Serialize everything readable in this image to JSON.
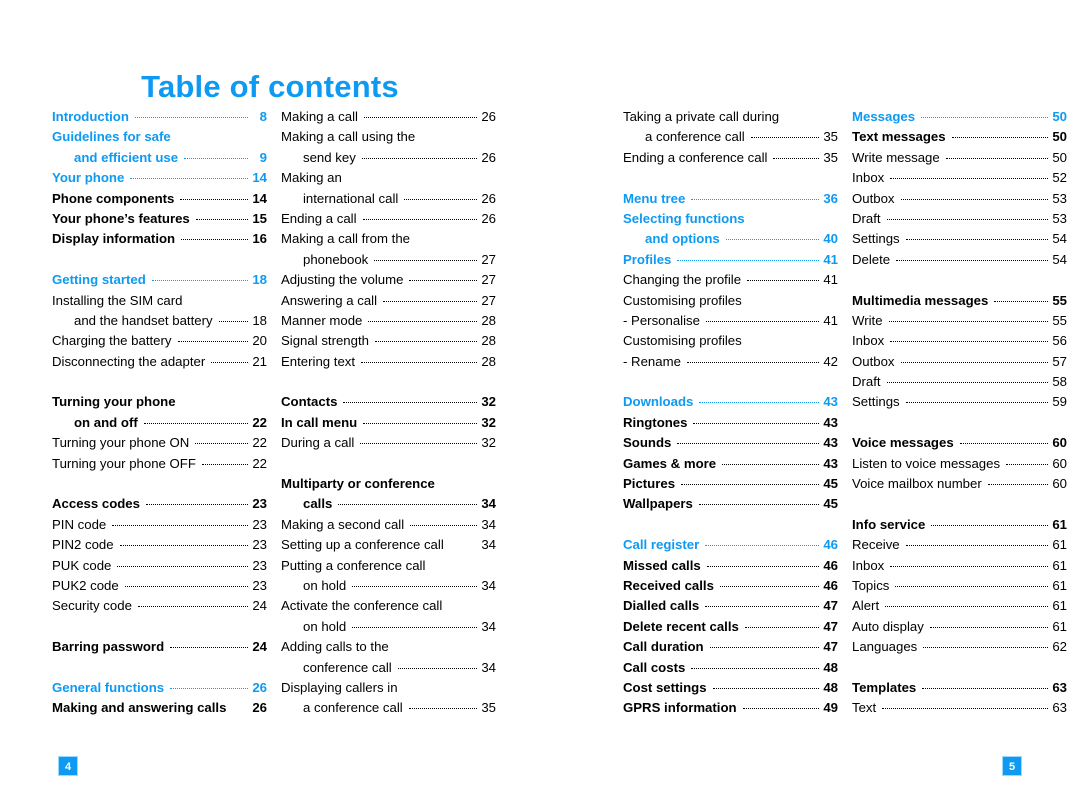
{
  "document": {
    "title": "Table of contents",
    "accent_color": "#0d9af2",
    "text_color": "#000000",
    "background_color": "#ffffff",
    "left_page_number": "4",
    "right_page_number": "5"
  },
  "columns": [
    {
      "id": "column-1",
      "entries": [
        {
          "label": "Introduction",
          "page": "8",
          "level": "section",
          "indent": false,
          "leader": true
        },
        {
          "label": "Guidelines for safe",
          "page": "",
          "level": "section",
          "indent": false,
          "leader": false
        },
        {
          "label": "and efficient use",
          "page": "9",
          "level": "section",
          "indent": true,
          "leader": true
        },
        {
          "label": "Your phone",
          "page": "14",
          "level": "section",
          "indent": false,
          "leader": true
        },
        {
          "label": "Phone components",
          "page": "14",
          "level": "sub",
          "indent": false,
          "leader": true
        },
        {
          "label": "Your phone’s features",
          "page": "15",
          "level": "sub",
          "indent": false,
          "leader": true
        },
        {
          "label": "Display information",
          "page": "16",
          "level": "sub",
          "indent": false,
          "leader": true
        },
        {
          "spacer": true
        },
        {
          "label": "Getting started",
          "page": "18",
          "level": "section",
          "indent": false,
          "leader": true
        },
        {
          "label": "Installing the SIM card",
          "page": "",
          "level": "item",
          "indent": false,
          "leader": false
        },
        {
          "label": "and the handset battery",
          "page": "18",
          "level": "item",
          "indent": true,
          "leader": true
        },
        {
          "label": "Charging the battery",
          "page": "20",
          "level": "item",
          "indent": false,
          "leader": true
        },
        {
          "label": "Disconnecting the adapter",
          "page": "21",
          "level": "item",
          "indent": false,
          "leader": true
        },
        {
          "spacer": true
        },
        {
          "label": "Turning your phone",
          "page": "",
          "level": "sub",
          "indent": false,
          "leader": false
        },
        {
          "label": "on and off",
          "page": "22",
          "level": "sub",
          "indent": true,
          "leader": true
        },
        {
          "label": "Turning your phone ON",
          "page": "22",
          "level": "item",
          "indent": false,
          "leader": true
        },
        {
          "label": "Turning your phone OFF",
          "page": "22",
          "level": "item",
          "indent": false,
          "leader": true
        },
        {
          "spacer": true
        },
        {
          "label": "Access codes",
          "page": "23",
          "level": "sub",
          "indent": false,
          "leader": true
        },
        {
          "label": "PIN code",
          "page": "23",
          "level": "item",
          "indent": false,
          "leader": true
        },
        {
          "label": "PIN2 code",
          "page": "23",
          "level": "item",
          "indent": false,
          "leader": true
        },
        {
          "label": "PUK code",
          "page": "23",
          "level": "item",
          "indent": false,
          "leader": true
        },
        {
          "label": "PUK2 code",
          "page": "23",
          "level": "item",
          "indent": false,
          "leader": true
        },
        {
          "label": "Security code",
          "page": "24",
          "level": "item",
          "indent": false,
          "leader": true
        },
        {
          "spacer": true
        },
        {
          "label": "Barring password",
          "page": "24",
          "level": "sub",
          "indent": false,
          "leader": true
        },
        {
          "spacer": true
        },
        {
          "label": "General functions",
          "page": "26",
          "level": "section",
          "indent": false,
          "leader": true
        },
        {
          "label": "Making and answering calls",
          "page": "26",
          "level": "sub",
          "indent": false,
          "leader": false
        }
      ]
    },
    {
      "id": "column-2",
      "entries": [
        {
          "label": "Making a call",
          "page": "26",
          "level": "item",
          "indent": false,
          "leader": true
        },
        {
          "label": "Making a call using the",
          "page": "",
          "level": "item",
          "indent": false,
          "leader": false
        },
        {
          "label": "send key",
          "page": "26",
          "level": "item",
          "indent": true,
          "leader": true
        },
        {
          "label": "Making an",
          "page": "",
          "level": "item",
          "indent": false,
          "leader": false
        },
        {
          "label": "international call",
          "page": "26",
          "level": "item",
          "indent": true,
          "leader": true
        },
        {
          "label": "Ending a call",
          "page": "26",
          "level": "item",
          "indent": false,
          "leader": true
        },
        {
          "label": "Making a call from the",
          "page": "",
          "level": "item",
          "indent": false,
          "leader": false
        },
        {
          "label": "phonebook",
          "page": "27",
          "level": "item",
          "indent": true,
          "leader": true
        },
        {
          "label": "Adjusting the volume",
          "page": "27",
          "level": "item",
          "indent": false,
          "leader": true
        },
        {
          "label": "Answering a call",
          "page": "27",
          "level": "item",
          "indent": false,
          "leader": true
        },
        {
          "label": "Manner mode",
          "page": "28",
          "level": "item",
          "indent": false,
          "leader": true
        },
        {
          "label": "Signal strength",
          "page": "28",
          "level": "item",
          "indent": false,
          "leader": true
        },
        {
          "label": "Entering text",
          "page": "28",
          "level": "item",
          "indent": false,
          "leader": true
        },
        {
          "spacer": true
        },
        {
          "label": "Contacts",
          "page": "32",
          "level": "sub",
          "indent": false,
          "leader": true
        },
        {
          "label": "In call menu",
          "page": "32",
          "level": "sub",
          "indent": false,
          "leader": true
        },
        {
          "label": "During a call",
          "page": "32",
          "level": "item",
          "indent": false,
          "leader": true
        },
        {
          "spacer": true
        },
        {
          "label": "Multiparty or conference",
          "page": "",
          "level": "sub",
          "indent": false,
          "leader": false
        },
        {
          "label": "calls",
          "page": "34",
          "level": "sub",
          "indent": true,
          "leader": true
        },
        {
          "label": "Making a second call",
          "page": "34",
          "level": "item",
          "indent": false,
          "leader": true
        },
        {
          "label": "Setting up a conference call",
          "page": "34",
          "level": "item",
          "indent": false,
          "leader": false
        },
        {
          "label": "Putting a conference call",
          "page": "",
          "level": "item",
          "indent": false,
          "leader": false
        },
        {
          "label": "on hold",
          "page": "34",
          "level": "item",
          "indent": true,
          "leader": true
        },
        {
          "label": "Activate the conference call",
          "page": "",
          "level": "item",
          "indent": false,
          "leader": false
        },
        {
          "label": "on hold",
          "page": "34",
          "level": "item",
          "indent": true,
          "leader": true
        },
        {
          "label": "Adding calls to the",
          "page": "",
          "level": "item",
          "indent": false,
          "leader": false
        },
        {
          "label": "conference call",
          "page": "34",
          "level": "item",
          "indent": true,
          "leader": true
        },
        {
          "label": "Displaying callers in",
          "page": "",
          "level": "item",
          "indent": false,
          "leader": false
        },
        {
          "label": "a conference call",
          "page": "35",
          "level": "item",
          "indent": true,
          "leader": true
        }
      ]
    },
    {
      "id": "column-3",
      "entries": [
        {
          "label": "Taking a private call during",
          "page": "",
          "level": "item",
          "indent": false,
          "leader": false
        },
        {
          "label": "a conference call",
          "page": "35",
          "level": "item",
          "indent": true,
          "leader": true
        },
        {
          "label": "Ending a conference call",
          "page": "35",
          "level": "item",
          "indent": false,
          "leader": true
        },
        {
          "spacer": true
        },
        {
          "label": "Menu tree",
          "page": "36",
          "level": "section",
          "indent": false,
          "leader": true
        },
        {
          "label": "Selecting functions",
          "page": "",
          "level": "section",
          "indent": false,
          "leader": false
        },
        {
          "label": "and options",
          "page": "40",
          "level": "section",
          "indent": true,
          "leader": true
        },
        {
          "label": "Profiles",
          "page": "41",
          "level": "section",
          "indent": false,
          "leader": true
        },
        {
          "label": "Changing the profile",
          "page": "41",
          "level": "item",
          "indent": false,
          "leader": true
        },
        {
          "label": "Customising profiles",
          "page": "",
          "level": "item",
          "indent": false,
          "leader": false
        },
        {
          "label": "- Personalise",
          "page": "41",
          "level": "item",
          "indent": false,
          "leader": true
        },
        {
          "label": "Customising profiles",
          "page": "",
          "level": "item",
          "indent": false,
          "leader": false
        },
        {
          "label": "- Rename",
          "page": "42",
          "level": "item",
          "indent": false,
          "leader": true
        },
        {
          "spacer": true
        },
        {
          "label": "Downloads",
          "page": "43",
          "level": "section",
          "indent": false,
          "leader": true
        },
        {
          "label": "Ringtones",
          "page": "43",
          "level": "sub",
          "indent": false,
          "leader": true
        },
        {
          "label": "Sounds",
          "page": "43",
          "level": "sub",
          "indent": false,
          "leader": true
        },
        {
          "label": "Games & more",
          "page": "43",
          "level": "sub",
          "indent": false,
          "leader": true
        },
        {
          "label": "Pictures",
          "page": "45",
          "level": "sub",
          "indent": false,
          "leader": true
        },
        {
          "label": "Wallpapers",
          "page": "45",
          "level": "sub",
          "indent": false,
          "leader": true
        },
        {
          "spacer": true
        },
        {
          "label": "Call register",
          "page": "46",
          "level": "section",
          "indent": false,
          "leader": true
        },
        {
          "label": "Missed calls",
          "page": "46",
          "level": "sub",
          "indent": false,
          "leader": true
        },
        {
          "label": "Received calls",
          "page": "46",
          "level": "sub",
          "indent": false,
          "leader": true
        },
        {
          "label": "Dialled calls",
          "page": "47",
          "level": "sub",
          "indent": false,
          "leader": true
        },
        {
          "label": "Delete recent calls",
          "page": "47",
          "level": "sub",
          "indent": false,
          "leader": true
        },
        {
          "label": "Call duration",
          "page": "47",
          "level": "sub",
          "indent": false,
          "leader": true
        },
        {
          "label": "Call costs",
          "page": "48",
          "level": "sub",
          "indent": false,
          "leader": true
        },
        {
          "label": "Cost settings",
          "page": "48",
          "level": "sub",
          "indent": false,
          "leader": true
        },
        {
          "label": "GPRS information",
          "page": "49",
          "level": "sub",
          "indent": false,
          "leader": true
        }
      ]
    },
    {
      "id": "column-4",
      "entries": [
        {
          "label": "Messages",
          "page": "50",
          "level": "section",
          "indent": false,
          "leader": true
        },
        {
          "label": "Text messages",
          "page": "50",
          "level": "sub",
          "indent": false,
          "leader": true
        },
        {
          "label": "Write message",
          "page": "50",
          "level": "item",
          "indent": false,
          "leader": true
        },
        {
          "label": "Inbox",
          "page": "52",
          "level": "item",
          "indent": false,
          "leader": true
        },
        {
          "label": "Outbox",
          "page": "53",
          "level": "item",
          "indent": false,
          "leader": true
        },
        {
          "label": "Draft",
          "page": "53",
          "level": "item",
          "indent": false,
          "leader": true
        },
        {
          "label": "Settings",
          "page": "54",
          "level": "item",
          "indent": false,
          "leader": true
        },
        {
          "label": "Delete",
          "page": "54",
          "level": "item",
          "indent": false,
          "leader": true
        },
        {
          "spacer": true
        },
        {
          "label": "Multimedia messages",
          "page": "55",
          "level": "sub",
          "indent": false,
          "leader": true
        },
        {
          "label": "Write",
          "page": "55",
          "level": "item",
          "indent": false,
          "leader": true
        },
        {
          "label": "Inbox",
          "page": "56",
          "level": "item",
          "indent": false,
          "leader": true
        },
        {
          "label": "Outbox",
          "page": "57",
          "level": "item",
          "indent": false,
          "leader": true
        },
        {
          "label": "Draft",
          "page": "58",
          "level": "item",
          "indent": false,
          "leader": true
        },
        {
          "label": "Settings",
          "page": "59",
          "level": "item",
          "indent": false,
          "leader": true
        },
        {
          "spacer": true
        },
        {
          "label": "Voice messages",
          "page": "60",
          "level": "sub",
          "indent": false,
          "leader": true
        },
        {
          "label": "Listen to voice messages",
          "page": "60",
          "level": "item",
          "indent": false,
          "leader": true
        },
        {
          "label": "Voice mailbox number",
          "page": "60",
          "level": "item",
          "indent": false,
          "leader": true
        },
        {
          "spacer": true
        },
        {
          "label": "Info service",
          "page": "61",
          "level": "sub",
          "indent": false,
          "leader": true
        },
        {
          "label": "Receive",
          "page": "61",
          "level": "item",
          "indent": false,
          "leader": true
        },
        {
          "label": "Inbox",
          "page": "61",
          "level": "item",
          "indent": false,
          "leader": true
        },
        {
          "label": "Topics",
          "page": "61",
          "level": "item",
          "indent": false,
          "leader": true
        },
        {
          "label": "Alert",
          "page": "61",
          "level": "item",
          "indent": false,
          "leader": true
        },
        {
          "label": "Auto display",
          "page": "61",
          "level": "item",
          "indent": false,
          "leader": true
        },
        {
          "label": "Languages",
          "page": "62",
          "level": "item",
          "indent": false,
          "leader": true
        },
        {
          "spacer": true
        },
        {
          "label": "Templates",
          "page": "63",
          "level": "sub",
          "indent": false,
          "leader": true
        },
        {
          "label": "Text",
          "page": "63",
          "level": "item",
          "indent": false,
          "leader": true
        }
      ]
    }
  ]
}
